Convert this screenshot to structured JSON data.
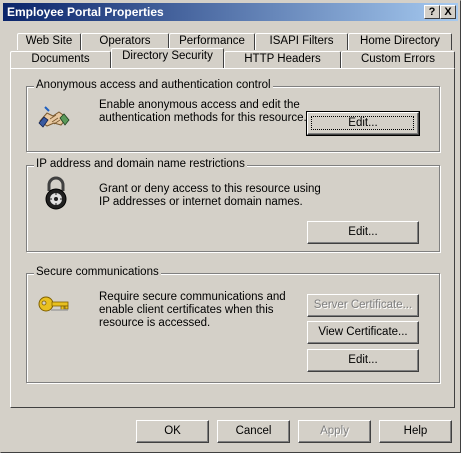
{
  "window": {
    "title": "Employee Portal Properties",
    "help_button": "?",
    "close_button": "X"
  },
  "tabs": {
    "row1": [
      "Web Site",
      "Operators",
      "Performance",
      "ISAPI Filters",
      "Home Directory"
    ],
    "row2": [
      "Documents",
      "Directory Security",
      "HTTP Headers",
      "Custom Errors"
    ],
    "active": "Directory Security"
  },
  "groups": {
    "anonymous": {
      "title": "Anonymous access and authentication control",
      "description": "Enable anonymous access and edit the\nauthentication methods for this resource.",
      "edit_button": "Edit...",
      "icon": "handshake-icon"
    },
    "ip": {
      "title": "IP address and domain name restrictions",
      "description": "Grant or deny access to this resource using\nIP addresses or internet domain names.",
      "edit_button": "Edit...",
      "icon": "padlock-icon"
    },
    "secure": {
      "title": "Secure communications",
      "description": "Require secure communications and\nenable client certificates when this\nresource is accessed.",
      "server_cert_button": "Server Certificate...",
      "view_cert_button": "View Certificate...",
      "edit_button": "Edit...",
      "icon": "key-icon"
    }
  },
  "footer": {
    "ok": "OK",
    "cancel": "Cancel",
    "apply": "Apply",
    "help": "Help"
  },
  "colors": {
    "titlebar_start": "#0a246a",
    "titlebar_end": "#a6caf0",
    "face": "#d4d0c8"
  }
}
